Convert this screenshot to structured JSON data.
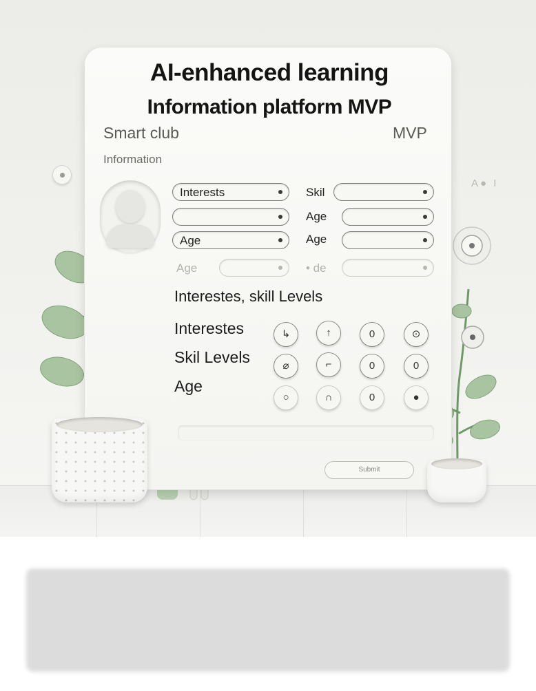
{
  "title": {
    "line1": "AI-enhanced learning",
    "line2": "Information platform MVP"
  },
  "subtitle": "Smart club",
  "mvp_tag": "MVP",
  "section_label": "Information",
  "side_text": "A● I",
  "fields": {
    "interests": "Interests",
    "skill": "Skil",
    "age_right": "Age",
    "age_left": "Age",
    "age_right2": "Age",
    "age_faint": "Age",
    "code_faint": "• de"
  },
  "section_heading": "Interestes, skill Levels",
  "rows": [
    "Interestes",
    "Skil Levels",
    "Age"
  ],
  "knobs": [
    [
      "↳",
      "↑",
      "0",
      "⊙"
    ],
    [
      "⌀",
      "⌐",
      "0",
      "0"
    ],
    [
      "○",
      "∩",
      "0",
      "●"
    ]
  ],
  "submit_label": "Submit",
  "colors": {
    "leaf": "#a9c4a0",
    "leaf_dark": "#7fa577",
    "stem": "#6f9a68"
  }
}
